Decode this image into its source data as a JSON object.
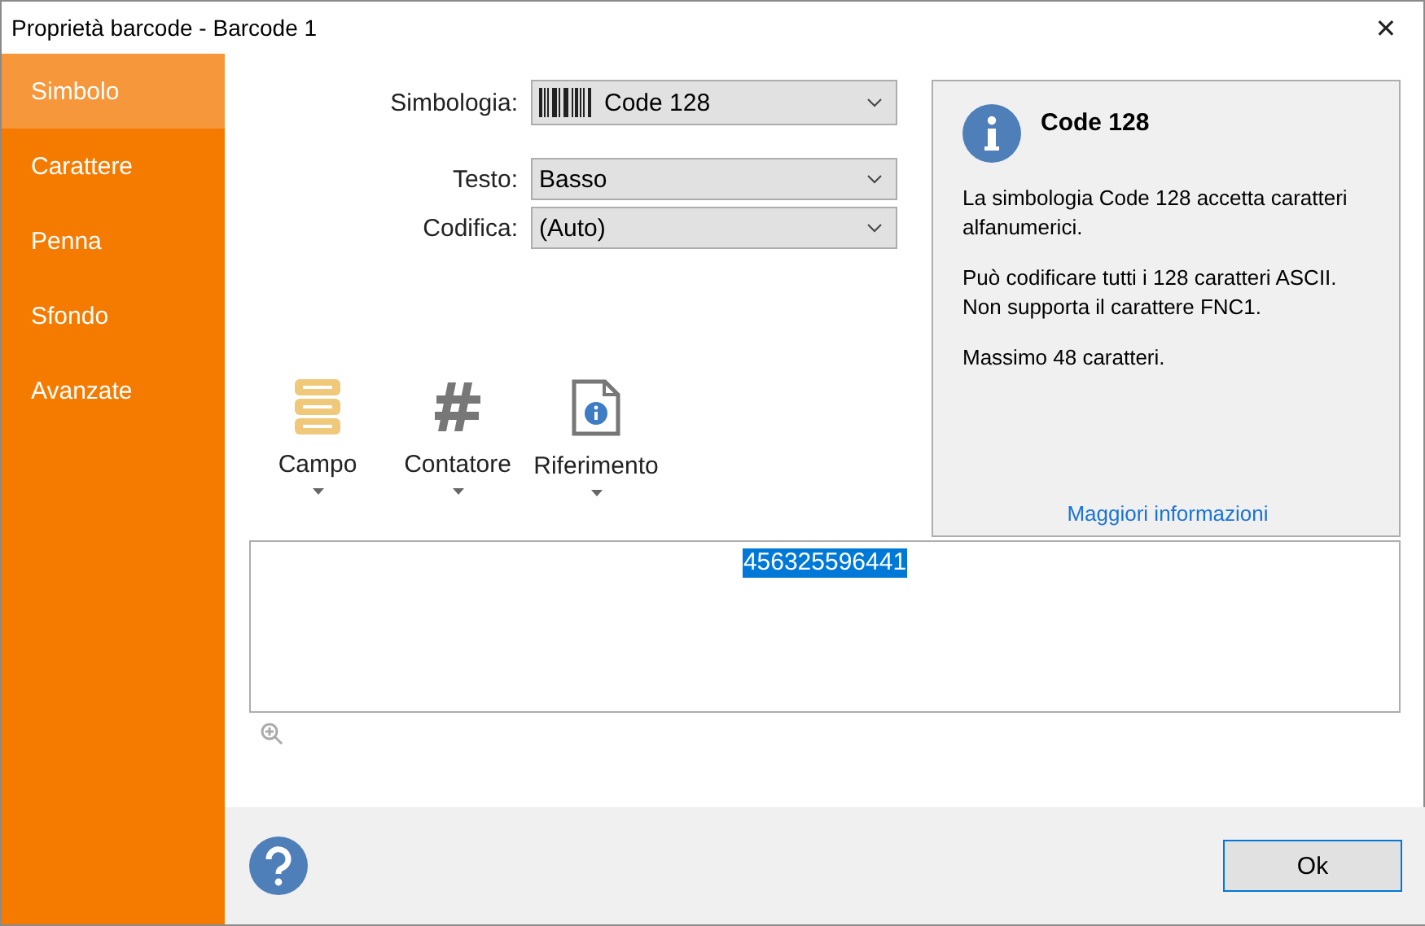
{
  "window": {
    "title": "Proprietà barcode - Barcode 1",
    "close": "✕"
  },
  "sidebar": {
    "items": [
      {
        "label": "Simbolo",
        "selected": true
      },
      {
        "label": "Carattere",
        "selected": false
      },
      {
        "label": "Penna",
        "selected": false
      },
      {
        "label": "Sfondo",
        "selected": false
      },
      {
        "label": "Avanzate",
        "selected": false
      }
    ]
  },
  "form": {
    "fields": [
      {
        "label": "Simbologia:",
        "value": "Code 128",
        "kind": "barcode"
      },
      {
        "label": "Testo:",
        "value": "Basso",
        "kind": "plain"
      },
      {
        "label": "Codifica:",
        "value": "(Auto)",
        "kind": "plain"
      }
    ]
  },
  "info": {
    "title": "Code 128",
    "paragraphs": [
      [
        "La simbologia Code 128 accetta caratteri",
        "alfanumerici."
      ],
      [
        "Può codificare tutti i 128 caratteri ASCII.",
        "Non supporta il carattere FNC1."
      ],
      [
        "Massimo 48 caratteri."
      ]
    ],
    "link": "Maggiori informazioni"
  },
  "toolbar": [
    {
      "label": "Campo",
      "kind": "field"
    },
    {
      "label": "Contatore",
      "kind": "counter"
    },
    {
      "label": "Riferimento",
      "kind": "reference"
    }
  ],
  "editor": {
    "value": "456325596441",
    "selected": true
  },
  "footer": {
    "ok": "Ok"
  }
}
